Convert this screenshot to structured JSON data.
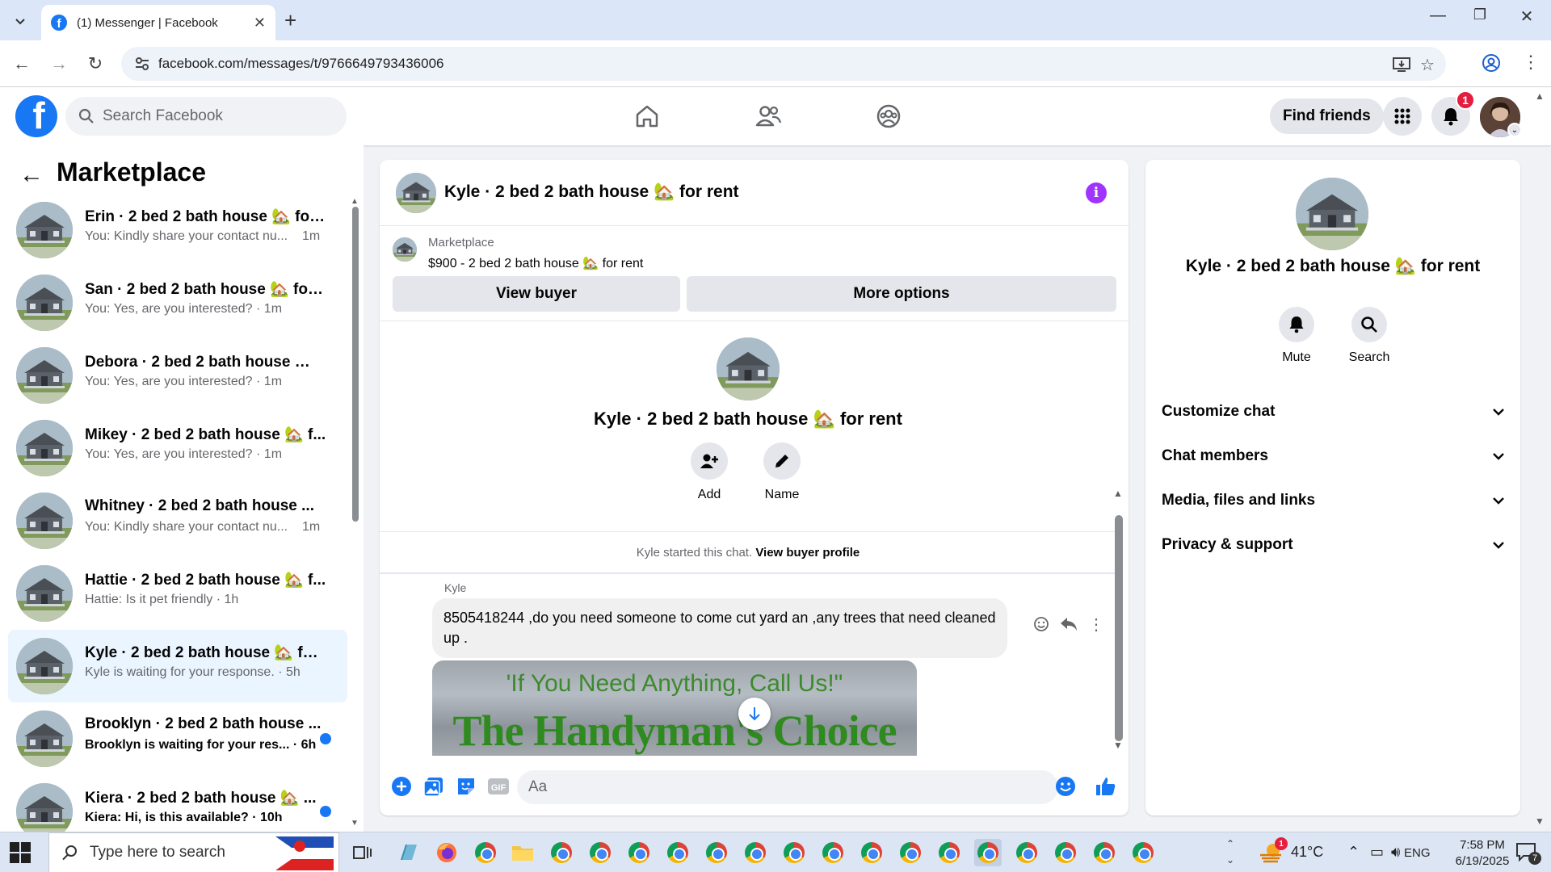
{
  "browser": {
    "tab_title": "(1) Messenger | Facebook",
    "url": "facebook.com/messages/t/9766649793436006"
  },
  "fb": {
    "search_placeholder": "Search Facebook",
    "find_friends": "Find friends",
    "notif_count": "1"
  },
  "sidebar": {
    "title": "Marketplace",
    "chats": [
      {
        "name": "Erin · 2 bed 2 bath house 🏡 for ...",
        "preview": "You: Kindly share your contact nu...",
        "time": "1m",
        "unread": false,
        "active": false
      },
      {
        "name": "San · 2 bed 2 bath house 🏡 for ...",
        "preview": "You: Yes, are you interested? · 1m",
        "time": "",
        "unread": false,
        "active": false
      },
      {
        "name": "Debora · 2 bed 2 bath house 🏡 ...",
        "preview": "You: Yes, are you interested? · 1m",
        "time": "",
        "unread": false,
        "active": false
      },
      {
        "name": "Mikey · 2 bed 2 bath house 🏡 f...",
        "preview": "You: Yes, are you interested? · 1m",
        "time": "",
        "unread": false,
        "active": false
      },
      {
        "name": "Whitney · 2 bed 2 bath house ...",
        "preview": "You: Kindly share your contact nu...",
        "time": "1m",
        "unread": false,
        "active": false
      },
      {
        "name": "Hattie · 2 bed 2 bath house 🏡 f...",
        "preview": "Hattie: Is it pet friendly · 1h",
        "time": "",
        "unread": false,
        "active": false
      },
      {
        "name": "Kyle · 2 bed 2 bath house 🏡 for...",
        "preview": "Kyle is waiting for your response. · 5h",
        "time": "",
        "unread": false,
        "active": true
      },
      {
        "name": "Brooklyn · 2 bed 2 bath house ...",
        "preview": "Brooklyn is waiting for your res... · 6h",
        "time": "",
        "unread": true,
        "active": false
      },
      {
        "name": "Kiera · 2 bed 2 bath house 🏡 ...",
        "preview": "Kiera: Hi, is this available? · 10h",
        "time": "",
        "unread": true,
        "active": false
      }
    ]
  },
  "conversation": {
    "title": "Kyle · 2 bed 2 bath house 🏡 for rent",
    "marketplace_label": "Marketplace",
    "listing": "$900 - 2 bed 2 bath house 🏡 for rent",
    "view_buyer": "View buyer",
    "more_options": "More options",
    "add_label": "Add",
    "name_label": "Name",
    "started_prefix": "Kyle started this chat.",
    "view_buyer_profile": "View buyer profile",
    "sender": "Kyle",
    "message": "8505418244 ,do you need someone to come cut yard an ,any trees that need cleaned up .",
    "image_line1": "'If You Need Anything, Call Us!\"",
    "image_line2": "The Handyman's Choice LLC",
    "composer_placeholder": "Aa"
  },
  "info_panel": {
    "name": "Kyle · 2 bed 2 bath house 🏡 for rent",
    "mute": "Mute",
    "search": "Search",
    "sections": [
      "Customize chat",
      "Chat members",
      "Media, files and links",
      "Privacy & support"
    ]
  },
  "taskbar": {
    "search_placeholder": "Type here to search",
    "weather_badge": "1",
    "temperature": "41°C",
    "language": "ENG",
    "time": "7:58 PM",
    "date": "6/19/2025",
    "notif_count": "7"
  },
  "colors": {
    "fb_blue": "#1877f2",
    "info_purple": "#a033ff",
    "active_chat_bg": "#ebf5ff"
  }
}
